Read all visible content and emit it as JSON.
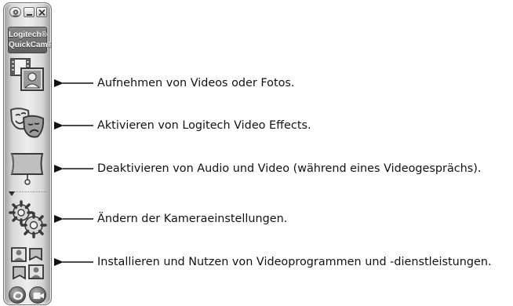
{
  "toolbar": {
    "logo_line1": "Logitech®",
    "logo_line2": "QuickCam®",
    "buttons": [
      {
        "name": "capture-button",
        "icon": "film-photo-icon",
        "description": "Aufnehmen von Videos oder Fotos."
      },
      {
        "name": "video-effects-button",
        "icon": "theater-masks-icon",
        "description": "Aktivieren von Logitech Video Effects."
      },
      {
        "name": "privacy-shade-button",
        "icon": "privacy-shade-icon",
        "description": "Deaktivieren von Audio und Video (während eines Videogesprächs)."
      },
      {
        "name": "camera-settings-button",
        "icon": "gears-icon",
        "description": "Ändern der Kameraeinstellungen."
      },
      {
        "name": "video-programs-button",
        "icon": "video-programs-icon",
        "description": "Installieren und Nutzen von Videoprogrammen und -dienstleistungen."
      }
    ]
  },
  "colors": {
    "toolbar_bg": "#e0e0e0",
    "icon_dark": "#4a4a4a",
    "icon_light": "#f2f2f2",
    "text": "#111111"
  }
}
